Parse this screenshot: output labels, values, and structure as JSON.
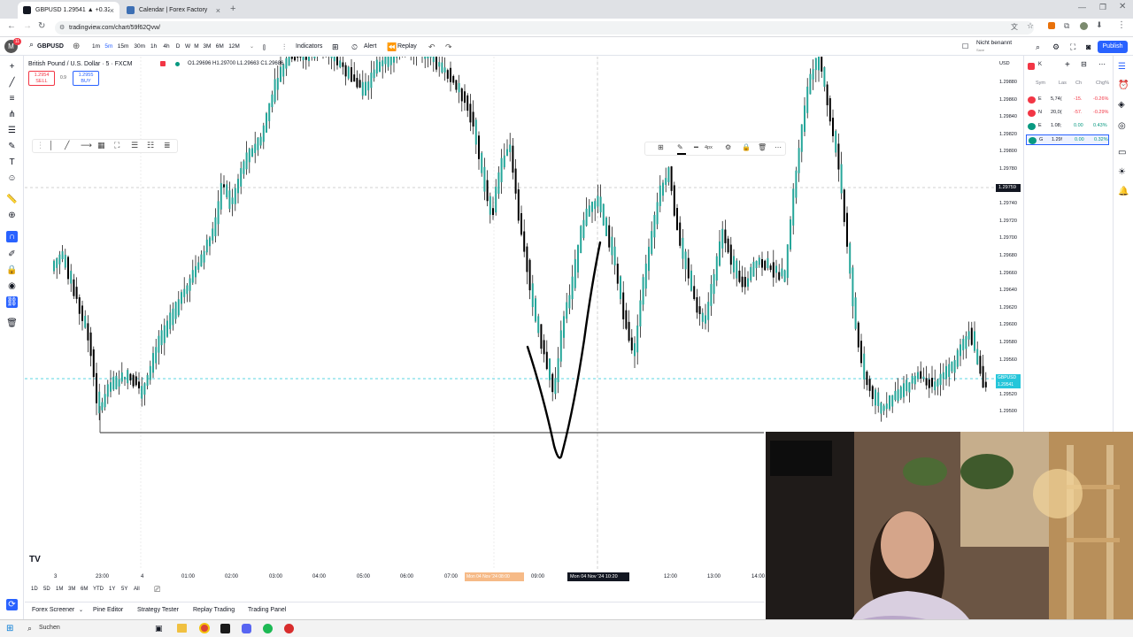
{
  "browser": {
    "tabs": [
      {
        "label": "GBPUSD 1.29541 ▲ +0.32% N...",
        "active": true
      },
      {
        "label": "Calendar | Forex Factory",
        "active": false
      }
    ],
    "url": "tradingview.com/chart/59f62Qvw/"
  },
  "header": {
    "symbol": "GBPUSD",
    "intervals": [
      "1m",
      "5m",
      "15m",
      "30m",
      "1h",
      "4h",
      "D",
      "W",
      "M",
      "3M",
      "6M",
      "12M"
    ],
    "active_interval": "5m",
    "indicators_label": "Indicators",
    "alert_label": "Alert",
    "replay_label": "Replay",
    "layout_name": "Nicht benannt",
    "layout_sub": "Save",
    "publish_label": "Publish",
    "avatar_badge": "11"
  },
  "legend": {
    "title": "British Pound / U.S. Dollar · 5 · FXCM",
    "ohlc": "O1.29696 H1.29700 L1.29663 C1.29686",
    "sell_price": "1.2954",
    "sell_label": "SELL",
    "spread": "0.9",
    "buy_price": "1.2955",
    "buy_label": "BUY"
  },
  "price_axis": {
    "currency": "USD",
    "labels": [
      "1.29880",
      "1.29860",
      "1.29840",
      "1.29820",
      "1.29800",
      "1.29780",
      "1.29759",
      "1.29740",
      "1.29720",
      "1.29700",
      "1.29680",
      "1.29660",
      "1.29640",
      "1.29620",
      "1.29600",
      "1.29580",
      "1.29560",
      "1.29541",
      "1.29520",
      "1.29500"
    ],
    "crosshair_price": "1.29759",
    "current_price": "1.29541",
    "current_tag": "GBPUSD"
  },
  "time_axis": {
    "labels": [
      "3",
      "23:00",
      "4",
      "01:00",
      "02:00",
      "03:00",
      "04:00",
      "05:00",
      "06:00",
      "07:00",
      "09:00",
      "12:00",
      "13:00",
      "14:00"
    ],
    "highlight_range": "Mon 04 Nov '24 08:00",
    "crosshair_time": "Mon 04 Nov '24  10:20"
  },
  "range_buttons": [
    "1D",
    "5D",
    "1M",
    "3M",
    "6M",
    "YTD",
    "1Y",
    "5Y",
    "All"
  ],
  "drawing_toolbar": {
    "width_label": "4px"
  },
  "bottom_tabs": [
    "Forex Screener",
    "Pine Editor",
    "Strategy Tester",
    "Replay Trading",
    "Trading Panel"
  ],
  "watchlist": {
    "columns": [
      "Sym",
      "Las",
      "Ch",
      "Chg%"
    ],
    "rows": [
      {
        "sym": "E",
        "last": "5,74(",
        "chg": "-15.",
        "pct": "-0.26%",
        "color": "#f23645"
      },
      {
        "sym": "N",
        "last": "20,0(",
        "chg": "-57.",
        "pct": "-0.29%",
        "color": "#f23645"
      },
      {
        "sym": "E",
        "last": "1.08;",
        "chg": "0.00",
        "pct": "0.43%",
        "color": "#089981"
      },
      {
        "sym": "G",
        "last": "1.29!",
        "chg": "0.00",
        "pct": "0.32%",
        "color": "#089981"
      }
    ]
  },
  "taskbar": {
    "search_placeholder": "Suchen"
  },
  "colors": {
    "up": "#26a69a",
    "down": "#000000",
    "accent": "#2962ff",
    "sell": "#f23645"
  }
}
